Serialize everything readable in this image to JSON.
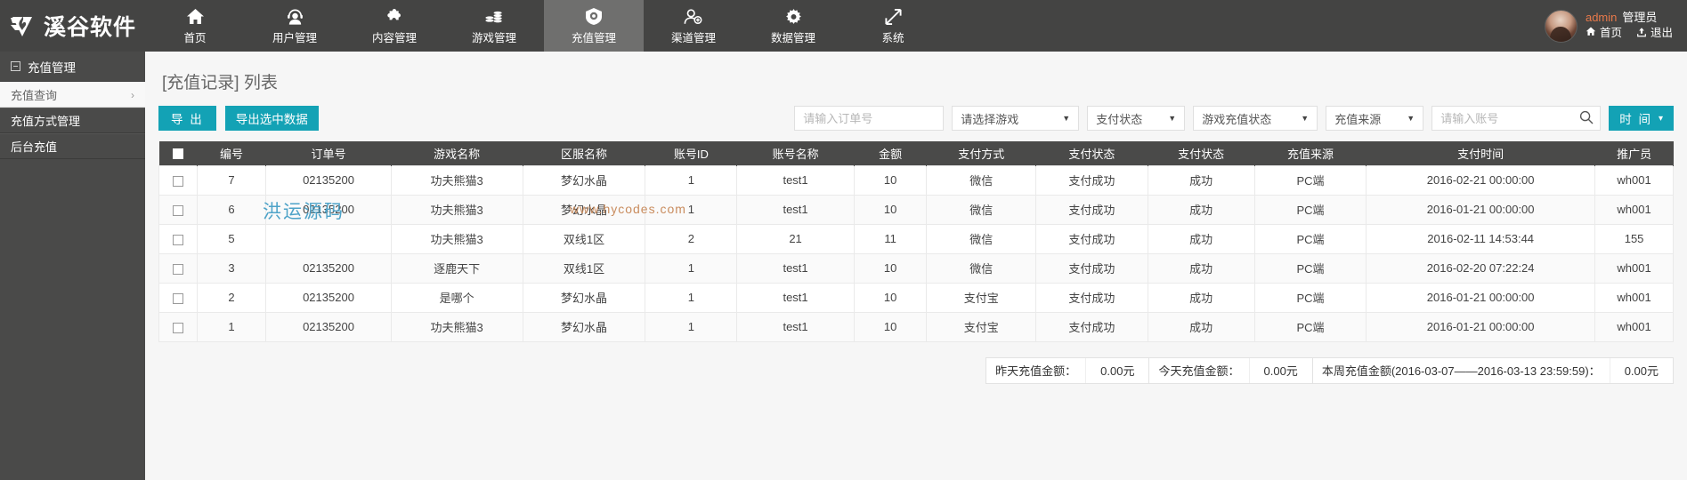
{
  "brand": {
    "name": "溪谷软件",
    "logo_icon": "flame-shield-logo-icon"
  },
  "nav": [
    {
      "label": "首页",
      "icon": "home-icon",
      "active": false
    },
    {
      "label": "用户管理",
      "icon": "user-headset-icon",
      "active": false
    },
    {
      "label": "内容管理",
      "icon": "puzzle-piece-icon",
      "active": false
    },
    {
      "label": "游戏管理",
      "icon": "coins-stack-icon",
      "active": false
    },
    {
      "label": "充值管理",
      "icon": "payment-badge-icon",
      "active": true
    },
    {
      "label": "渠道管理",
      "icon": "user-add-icon",
      "active": false
    },
    {
      "label": "数据管理",
      "icon": "gear-icon",
      "active": false
    },
    {
      "label": "系统",
      "icon": "expand-arrows-icon",
      "active": false
    }
  ],
  "user": {
    "name": "admin",
    "role": "管理员",
    "home_link": "首页",
    "logout_link": "退出",
    "name_color": "#e8794a"
  },
  "sidebar": {
    "header": "充值管理",
    "items": [
      {
        "label": "充值查询",
        "active": true
      },
      {
        "label": "充值方式管理",
        "active": false
      },
      {
        "label": "后台充值",
        "active": false
      }
    ]
  },
  "page": {
    "title": "[充值记录] 列表"
  },
  "toolbar": {
    "export_label": "导 出",
    "export_selected_label": "导出选中数据",
    "accent_color": "#13a2b5"
  },
  "filters": {
    "order_no_placeholder": "请输入订单号",
    "order_no_value": "",
    "game_select": "请选择游戏",
    "pay_status_select": "支付状态",
    "game_pay_status_select": "游戏充值状态",
    "recharge_source_select": "充值来源",
    "account_placeholder": "请输入账号",
    "account_value": "",
    "time_button": "时 间"
  },
  "table": {
    "columns": [
      "编号",
      "订单号",
      "游戏名称",
      "区服名称",
      "账号ID",
      "账号名称",
      "金额",
      "支付方式",
      "支付状态",
      "支付状态",
      "充值来源",
      "支付时间",
      "推广员"
    ],
    "rows": [
      {
        "id": "7",
        "order_no": "02135200",
        "game": "功夫熊猫3",
        "server": "梦幻水晶",
        "account_id": "1",
        "account_name": "test1",
        "amount": "10",
        "pay_method": "微信",
        "pay_status": "支付成功",
        "pay_status2": "成功",
        "source": "PC端",
        "pay_time": "2016-02-21 00:00:00",
        "promoter": "wh001"
      },
      {
        "id": "6",
        "order_no": "02135200",
        "game": "功夫熊猫3",
        "server": "梦幻水晶",
        "account_id": "1",
        "account_name": "test1",
        "amount": "10",
        "pay_method": "微信",
        "pay_status": "支付成功",
        "pay_status2": "成功",
        "source": "PC端",
        "pay_time": "2016-01-21 00:00:00",
        "promoter": "wh001"
      },
      {
        "id": "5",
        "order_no": "",
        "game": "功夫熊猫3",
        "server": "双线1区",
        "account_id": "2",
        "account_name": "21",
        "amount": "11",
        "pay_method": "微信",
        "pay_status": "支付成功",
        "pay_status2": "成功",
        "source": "PC端",
        "pay_time": "2016-02-11 14:53:44",
        "promoter": "155"
      },
      {
        "id": "3",
        "order_no": "02135200",
        "game": "逐鹿天下",
        "server": "双线1区",
        "account_id": "1",
        "account_name": "test1",
        "amount": "10",
        "pay_method": "微信",
        "pay_status": "支付成功",
        "pay_status2": "成功",
        "source": "PC端",
        "pay_time": "2016-02-20 07:22:24",
        "promoter": "wh001"
      },
      {
        "id": "2",
        "order_no": "02135200",
        "game": "是哪个",
        "server": "梦幻水晶",
        "account_id": "1",
        "account_name": "test1",
        "amount": "10",
        "pay_method": "支付宝",
        "pay_status": "支付成功",
        "pay_status2": "成功",
        "source": "PC端",
        "pay_time": "2016-01-21 00:00:00",
        "promoter": "wh001"
      },
      {
        "id": "1",
        "order_no": "02135200",
        "game": "功夫熊猫3",
        "server": "梦幻水晶",
        "account_id": "1",
        "account_name": "test1",
        "amount": "10",
        "pay_method": "支付宝",
        "pay_status": "支付成功",
        "pay_status2": "成功",
        "source": "PC端",
        "pay_time": "2016-01-21 00:00:00",
        "promoter": "wh001"
      }
    ]
  },
  "watermarks": {
    "line1": "洪运源码",
    "line2": "www.hycodes.com"
  },
  "summary": {
    "yesterday_label": "昨天充值金额：",
    "yesterday_value": "0.00元",
    "today_label": "今天充值金额：",
    "today_value": "0.00元",
    "week_label": "本周充值金额(2016-03-07——2016-03-13 23:59:59)：",
    "week_value": "0.00元"
  }
}
